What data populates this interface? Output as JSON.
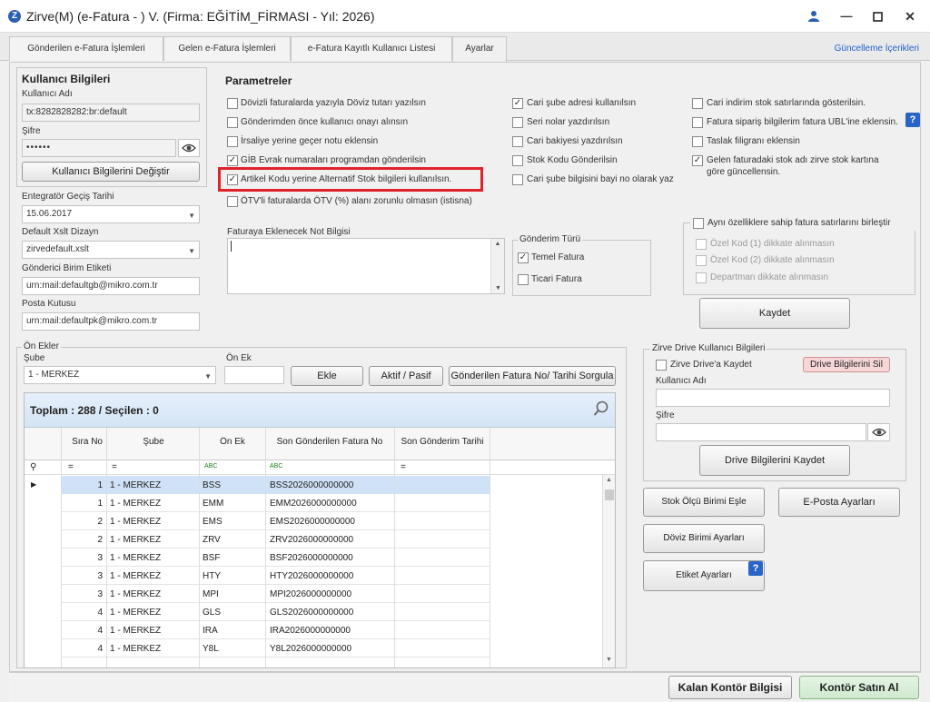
{
  "window": {
    "title": "Zirve(M)  (e-Fatura - ) V. (Firma: EĞİTİM_FİRMASI - Yıl: 2026)",
    "logo": "Z",
    "controls": [
      "user-icon",
      "minimize-icon",
      "maximize-icon",
      "close-icon"
    ]
  },
  "tabs": [
    {
      "label": "Gönderilen e-Fatura İşlemleri"
    },
    {
      "label": "Gelen e-Fatura İşlemleri"
    },
    {
      "label": "e-Fatura Kayıtlı Kullanıcı Listesi"
    },
    {
      "label": "Ayarlar",
      "active": true
    }
  ],
  "update_link": "Güncelleme İçerikleri",
  "user_info": {
    "header": "Kullanıcı Bilgileri",
    "username_label": "Kullanıcı Adı",
    "username": "tx:8282828282:br:default",
    "password_label": "Şifre",
    "password": "••••••",
    "change_button": "Kullanıcı Bilgilerini Değiştir"
  },
  "integrator": {
    "date_label": "Entegratör Geçiş Tarihi",
    "date": "15.06.2017",
    "xslt_label": "Default Xslt Dizayn",
    "xslt": "zirvedefault.xslt",
    "sender_label": "Gönderici Birim Etiketi",
    "sender": "urn:mail:defaultgb@mikro.com.tr",
    "mailbox_label": "Posta Kutusu",
    "mailbox": "urn:mail:defaultpk@mikro.com.tr"
  },
  "parameters": {
    "header": "Parametreler",
    "col1": [
      {
        "label": "Dövizli faturalarda yazıyla Döviz tutarı yazılsın",
        "checked": false
      },
      {
        "label": "Gönderimden önce kullanıcı onayı alınsın",
        "checked": false
      },
      {
        "label": "İrsaliye yerine geçer notu eklensin",
        "checked": false
      },
      {
        "label": "GİB Evrak numaraları programdan gönderilsin",
        "checked": true
      },
      {
        "label": "Artikel Kodu yerine Alternatif Stok bilgileri kullanılsın.",
        "checked": true,
        "highlighted": true
      },
      {
        "label": "ÖTV'li faturalarda ÖTV (%) alanı zorunlu olmasın (istisna)",
        "checked": false
      }
    ],
    "col2": [
      {
        "label": "Cari şube adresi kullanılsın",
        "checked": true
      },
      {
        "label": "Seri nolar yazdırılsın",
        "checked": false
      },
      {
        "label": "Cari bakiyesi yazdırılsın",
        "checked": false
      },
      {
        "label": "Stok Kodu Gönderilsin",
        "checked": false
      },
      {
        "label": "Cari şube bilgisini bayi no olarak yaz",
        "checked": false
      }
    ],
    "col3": [
      {
        "label": "Cari indirim stok satırlarında gösterilsin.",
        "checked": false
      },
      {
        "label": "Fatura sipariş bilgilerim fatura UBL'ine eklensin.",
        "checked": false
      },
      {
        "label": "Taslak filigranı eklensin",
        "checked": false
      },
      {
        "label": "Gelen faturadaki stok adı zirve stok kartına",
        "label2": "göre güncellensin.",
        "checked": true
      }
    ],
    "note_label": "Faturaya Eklenecek Not Bilgisi",
    "note_value": "",
    "send_type": {
      "label": "Gönderim Türü",
      "options": [
        {
          "label": "Temel Fatura",
          "checked": true
        },
        {
          "label": "Ticari Fatura",
          "checked": false
        }
      ]
    },
    "merge": {
      "label": "Aynı özelliklere sahip fatura satırlarını birleştir",
      "checked": false,
      "options": [
        "Özel Kod (1) dikkate alınmasın",
        "Özel Kod (2) dikkate alınmasın",
        "Departman dikkate alınmasın"
      ]
    },
    "save_button": "Kaydet"
  },
  "prefixes": {
    "header": "Ön Ekler",
    "branch_label": "Şube",
    "branch": "1 - MERKEZ",
    "prefix_label": "Ön Ek",
    "prefix_value": "",
    "buttons": {
      "add": "Ekle",
      "toggle": "Aktif / Pasif",
      "query": "Gönderilen Fatura No/ Tarihi Sorgula"
    },
    "total": "Toplam : 288 / Seçilen : 0",
    "columns": [
      "Sıra No",
      "Şube",
      "Ön Ek",
      "Son Gönderilen Fatura No",
      "Son Gönderim Tarihi"
    ],
    "filter_ops": [
      "=",
      "=",
      "ABC",
      "ABC",
      "="
    ],
    "rows": [
      {
        "no": "1",
        "branch": "1 - MERKEZ",
        "prefix": "BSS",
        "last_no": "BSS2026000000000",
        "date": ""
      },
      {
        "no": "1",
        "branch": "1 - MERKEZ",
        "prefix": "EMM",
        "last_no": "EMM2026000000000",
        "date": ""
      },
      {
        "no": "2",
        "branch": "1 - MERKEZ",
        "prefix": "EMS",
        "last_no": "EMS2026000000000",
        "date": ""
      },
      {
        "no": "2",
        "branch": "1 - MERKEZ",
        "prefix": "ZRV",
        "last_no": "ZRV2026000000000",
        "date": ""
      },
      {
        "no": "3",
        "branch": "1 - MERKEZ",
        "prefix": "BSF",
        "last_no": "BSF2026000000000",
        "date": ""
      },
      {
        "no": "3",
        "branch": "1 - MERKEZ",
        "prefix": "HTY",
        "last_no": "HTY2026000000000",
        "date": ""
      },
      {
        "no": "3",
        "branch": "1 - MERKEZ",
        "prefix": "MPI",
        "last_no": "MPI2026000000000",
        "date": ""
      },
      {
        "no": "4",
        "branch": "1 - MERKEZ",
        "prefix": "GLS",
        "last_no": "GLS2026000000000",
        "date": ""
      },
      {
        "no": "4",
        "branch": "1 - MERKEZ",
        "prefix": "IRA",
        "last_no": "IRA2026000000000",
        "date": ""
      },
      {
        "no": "4",
        "branch": "1 - MERKEZ",
        "prefix": "Y8L",
        "last_no": "Y8L2026000000000",
        "date": ""
      }
    ]
  },
  "drive": {
    "header": "Zirve Drive Kullanıcı Bilgileri",
    "save_checkbox": "Zirve Drive'a Kaydet",
    "delete_button": "Drive Bilgilerini Sil",
    "username_label": "Kullanıcı Adı",
    "username": "",
    "password_label": "Şifre",
    "password": "",
    "save_button": "Drive Bilgilerini Kaydet"
  },
  "side_buttons": {
    "unit": "Stok Ölçü Birimi Eşle",
    "email": "E-Posta Ayarları",
    "currency": "Döviz Birimi Ayarları",
    "label": "Etiket Ayarları"
  },
  "status": {
    "credit_info": "Kalan Kontör Bilgisi",
    "buy_credit": "Kontör Satın Al"
  }
}
